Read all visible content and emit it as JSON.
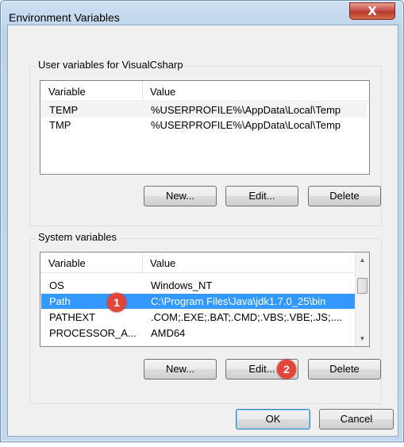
{
  "window": {
    "title": "Environment Variables",
    "close_label": "X"
  },
  "user_vars": {
    "group_label": "User variables for VisualCsharp",
    "columns": [
      "Variable",
      "Value"
    ],
    "rows": [
      {
        "variable": "TEMP",
        "value": "%USERPROFILE%\\AppData\\Local\\Temp"
      },
      {
        "variable": "TMP",
        "value": "%USERPROFILE%\\AppData\\Local\\Temp"
      }
    ],
    "buttons": {
      "new": "New...",
      "edit": "Edit...",
      "delete": "Delete"
    }
  },
  "system_vars": {
    "group_label": "System variables",
    "columns": [
      "Variable",
      "Value"
    ],
    "rows": [
      {
        "variable": "OS",
        "value": "Windows_NT"
      },
      {
        "variable": "Path",
        "value": "C:\\Program Files\\Java\\jdk1.7.0_25\\bin"
      },
      {
        "variable": "PATHEXT",
        "value": ".COM;.EXE;.BAT;.CMD;.VBS;.VBE;.JS;...."
      },
      {
        "variable": "PROCESSOR_A...",
        "value": "AMD64"
      }
    ],
    "selected_row": 1,
    "buttons": {
      "new": "New...",
      "edit": "Edit...",
      "delete": "Delete"
    }
  },
  "dialog_buttons": {
    "ok": "OK",
    "cancel": "Cancel"
  },
  "annotations": {
    "step1": "1",
    "step2": "2"
  },
  "colors": {
    "selection": "#3399ff",
    "badge": "#e2453a",
    "title_gradient": "#bcd3ea"
  },
  "icons": {
    "scroll_up": "scroll-up-arrow-icon",
    "scroll_down": "scroll-down-arrow-icon",
    "close": "close-icon"
  }
}
